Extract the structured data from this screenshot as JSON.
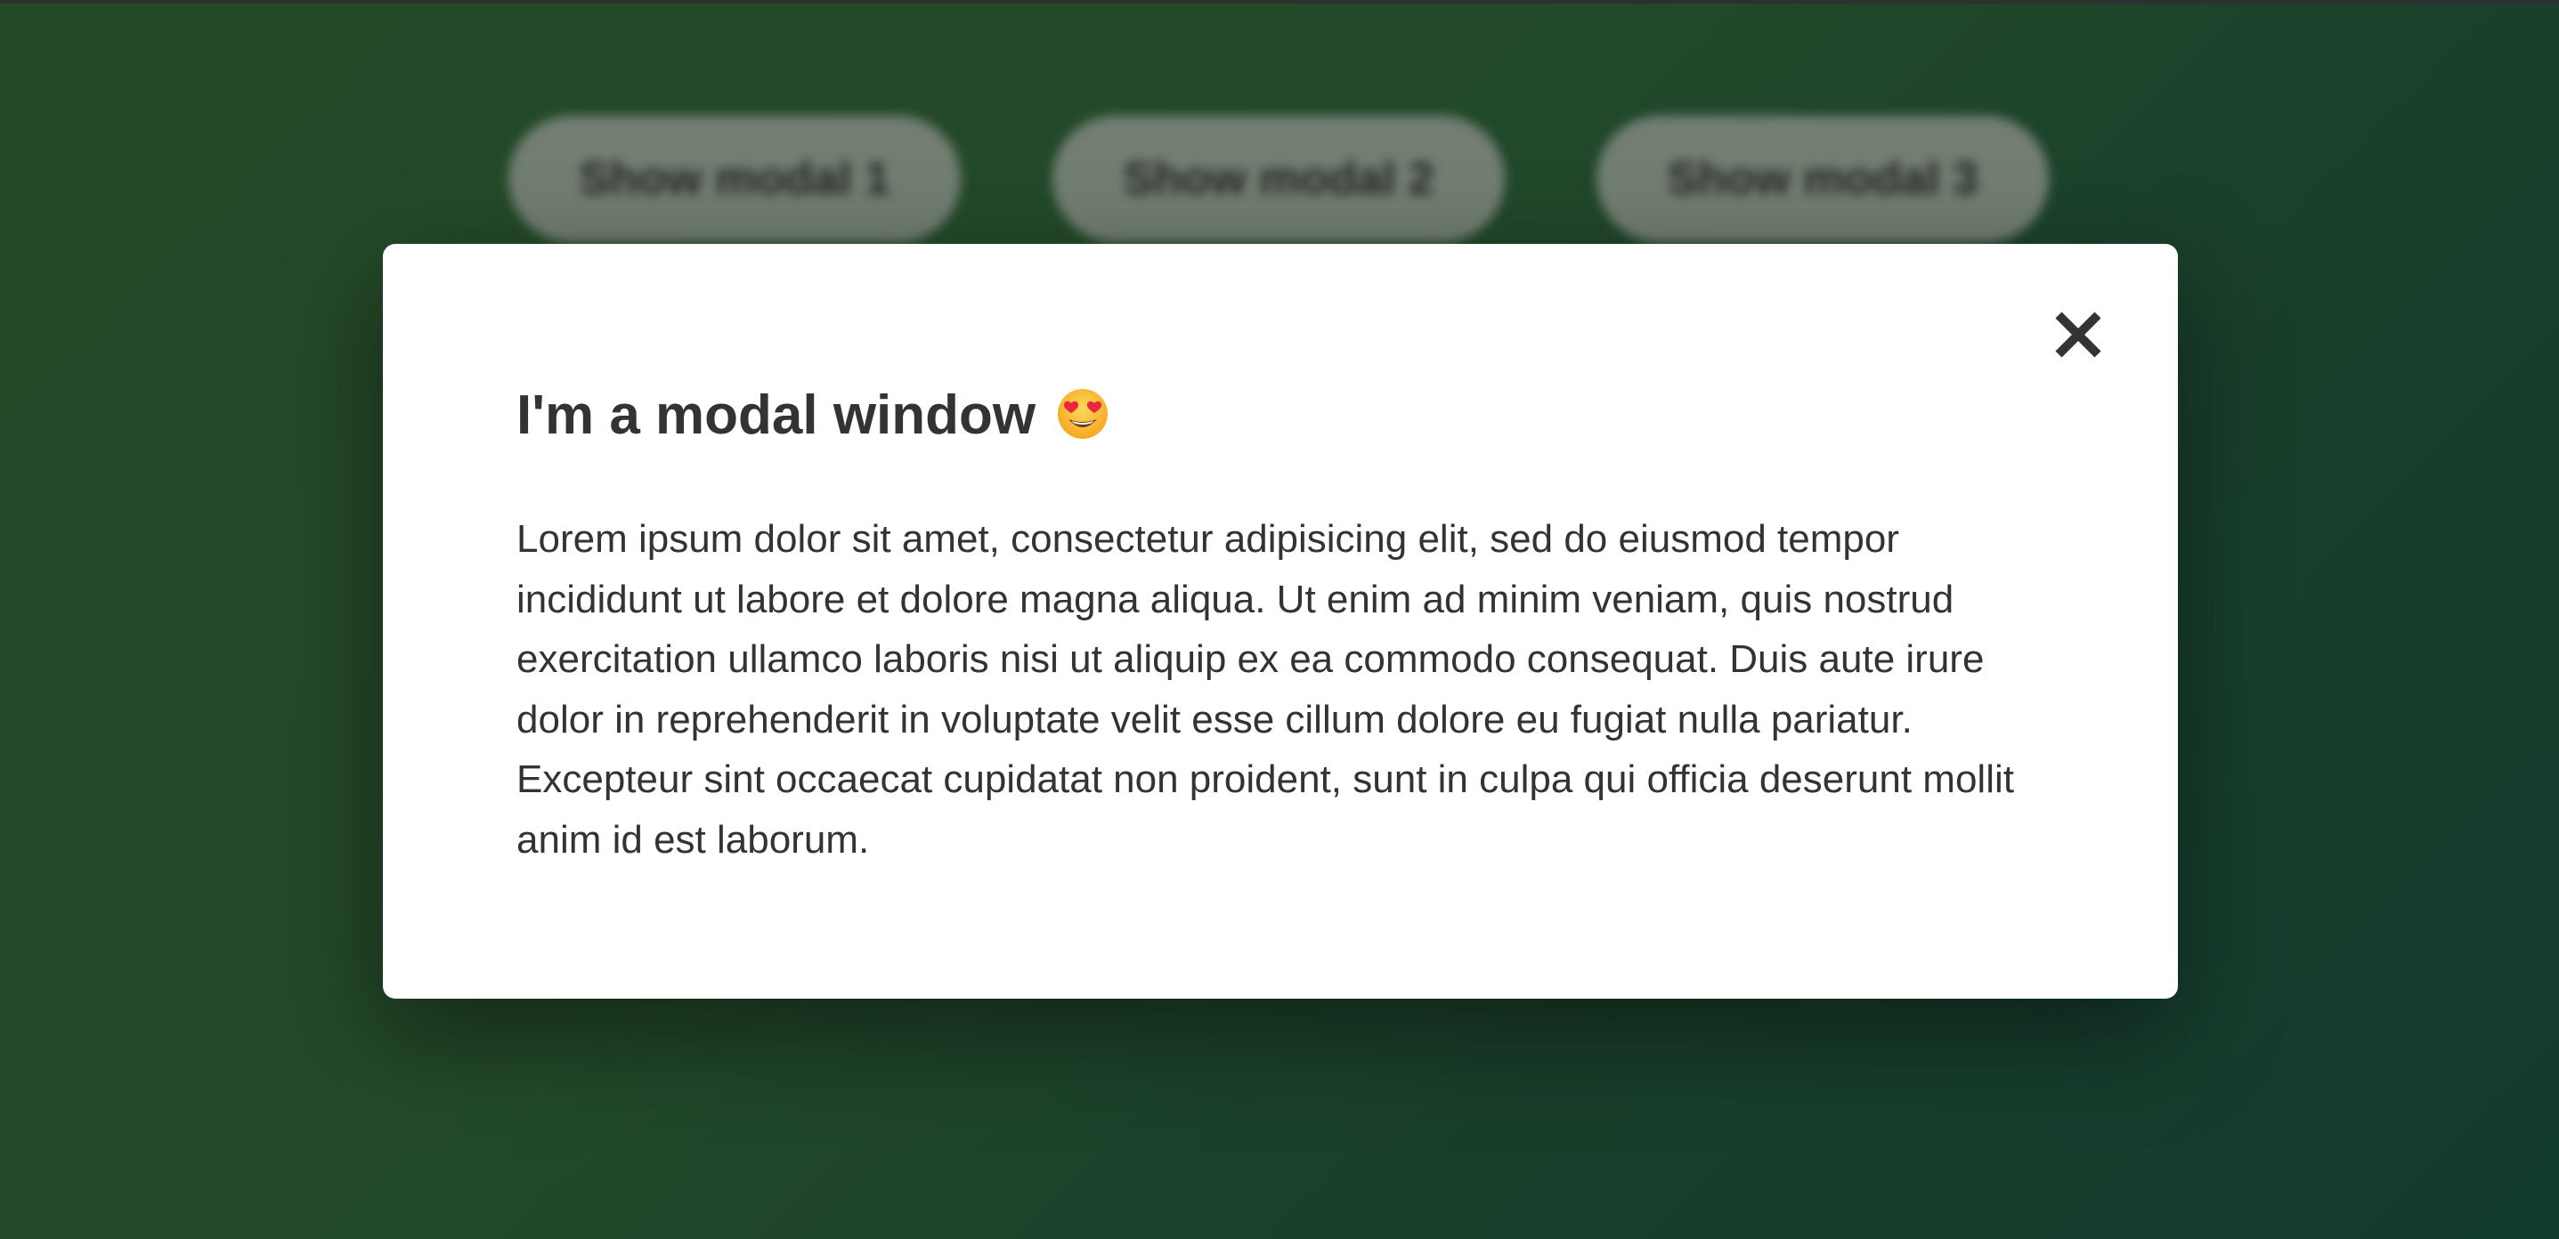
{
  "buttons": [
    {
      "label": "Show modal 1"
    },
    {
      "label": "Show modal 2"
    },
    {
      "label": "Show modal 3"
    }
  ],
  "modal": {
    "title": "I'm a modal window",
    "title_emoji": "smiling-face-with-heart-eyes-icon",
    "body": "Lorem ipsum dolor sit amet, consectetur adipisicing elit, sed do eiusmod tempor incididunt ut labore et dolore magna aliqua. Ut enim ad minim veniam, quis nostrud exercitation ullamco laboris nisi ut aliquip ex ea commodo consequat. Duis aute irure dolor in reprehenderit in voluptate velit esse cillum dolore eu fugiat nulla pariatur. Excepteur sint occaecat cupidatat non proident, sunt in culpa qui officia deserunt mollit anim id est laborum.",
    "close_icon": "close-icon"
  },
  "colors": {
    "background_start": "#2d5a2f",
    "background_end": "#174a3a",
    "modal_bg": "#ffffff",
    "text": "#333333",
    "button_bg": "#8c9a8c"
  }
}
